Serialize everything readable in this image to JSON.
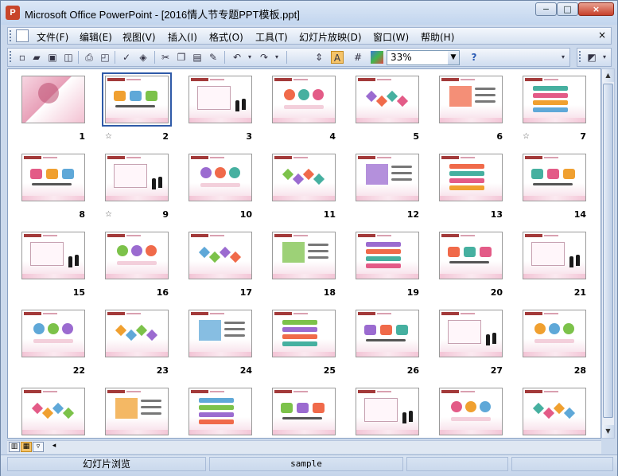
{
  "window": {
    "app_icon_letter": "P",
    "title": "Microsoft Office PowerPoint - [2016情人节专题PPT模板.ppt]",
    "minimize": "−",
    "maximize": "□",
    "close": "×"
  },
  "menubar": {
    "items": [
      "文件(F)",
      "编辑(E)",
      "视图(V)",
      "插入(I)",
      "格式(O)",
      "工具(T)",
      "幻灯片放映(D)",
      "窗口(W)",
      "帮助(H)"
    ],
    "close_label": "×"
  },
  "toolbar": {
    "zoom_value": "33%",
    "buttons": [
      "new-icon",
      "open-icon",
      "save-icon",
      "permission-icon",
      "print-icon",
      "print-preview-icon",
      "spelling-icon",
      "research-icon",
      "cut-icon",
      "copy-icon",
      "paste-icon",
      "format-painter-icon",
      "undo-icon",
      "redo-icon",
      "expand-all-icon",
      "show-formatting-icon",
      "show-grid-icon",
      "color-grayscale-icon",
      "help-icon"
    ]
  },
  "slides": [
    {
      "n": "1",
      "star": false
    },
    {
      "n": "2",
      "star": true,
      "selected": true
    },
    {
      "n": "3",
      "star": false
    },
    {
      "n": "4",
      "star": false
    },
    {
      "n": "5",
      "star": false
    },
    {
      "n": "6",
      "star": false
    },
    {
      "n": "7",
      "star": true
    },
    {
      "n": "8",
      "star": false
    },
    {
      "n": "9",
      "star": true
    },
    {
      "n": "10",
      "star": false
    },
    {
      "n": "11",
      "star": false
    },
    {
      "n": "12",
      "star": false
    },
    {
      "n": "13",
      "star": false
    },
    {
      "n": "14",
      "star": false
    },
    {
      "n": "15",
      "star": false
    },
    {
      "n": "16",
      "star": false
    },
    {
      "n": "17",
      "star": false
    },
    {
      "n": "18",
      "star": false
    },
    {
      "n": "19",
      "star": false
    },
    {
      "n": "20",
      "star": false
    },
    {
      "n": "21",
      "star": false
    },
    {
      "n": "22",
      "star": false
    },
    {
      "n": "23",
      "star": false
    },
    {
      "n": "24",
      "star": false
    },
    {
      "n": "25",
      "star": false
    },
    {
      "n": "26",
      "star": false
    },
    {
      "n": "27",
      "star": false
    },
    {
      "n": "28",
      "star": false
    },
    {
      "n": "",
      "star": false
    },
    {
      "n": "",
      "star": false
    },
    {
      "n": "",
      "star": false
    },
    {
      "n": "",
      "star": false
    },
    {
      "n": "",
      "star": false
    },
    {
      "n": "",
      "star": false
    },
    {
      "n": "",
      "star": false
    }
  ],
  "star_glyph": "☆",
  "status": {
    "view": "幻灯片浏览",
    "design": "sample"
  },
  "colors": {
    "accent": "#a33a3a",
    "selection": "#2f5aa8"
  }
}
